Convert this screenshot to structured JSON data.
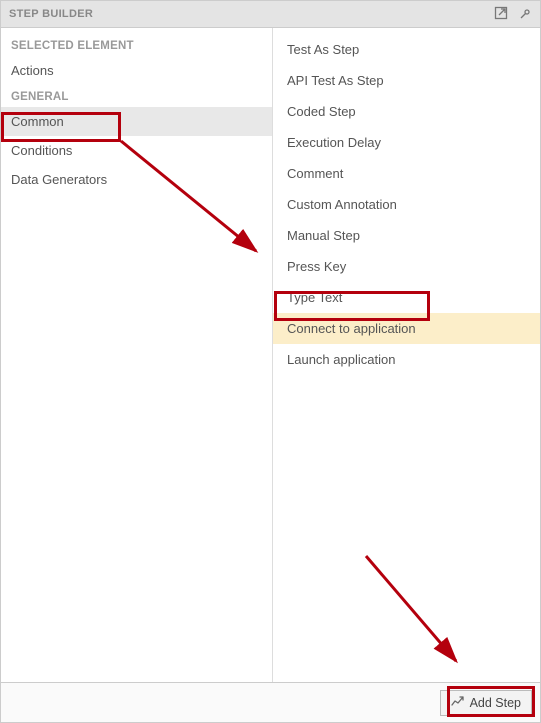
{
  "titlebar": {
    "label": "STEP BUILDER"
  },
  "left": {
    "sectionSelected": "SELECTED ELEMENT",
    "actions": "Actions",
    "sectionGeneral": "GENERAL",
    "items": {
      "common": "Common",
      "conditions": "Conditions",
      "dataGenerators": "Data Generators"
    }
  },
  "steps": {
    "testAsStep": "Test As Step",
    "apiTestAsStep": "API Test As Step",
    "codedStep": "Coded Step",
    "executionDelay": "Execution Delay",
    "comment": "Comment",
    "customAnnotation": "Custom Annotation",
    "manualStep": "Manual Step",
    "pressKey": "Press Key",
    "typeText": "Type Text",
    "connectToApplication": "Connect to application",
    "launchApplication": "Launch application"
  },
  "footer": {
    "addStep": "Add Step"
  }
}
